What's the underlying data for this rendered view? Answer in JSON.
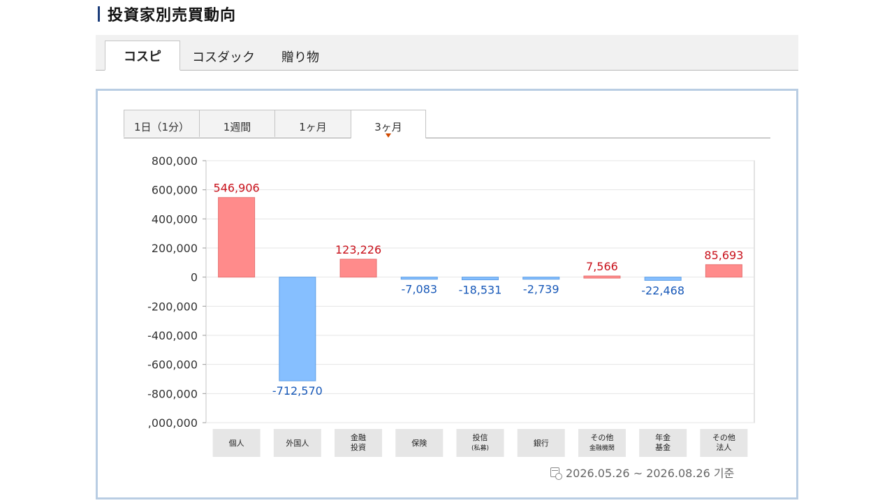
{
  "page": {
    "title": "投資家別売買動向"
  },
  "market_tabs": [
    {
      "label": "コスピ",
      "active": true
    },
    {
      "label": "コスダック",
      "active": false
    },
    {
      "label": "贈り物",
      "active": false
    }
  ],
  "period_tabs": [
    {
      "label": "1日（1分）",
      "active": false
    },
    {
      "label": "1週間",
      "active": false
    },
    {
      "label": "1ヶ月",
      "active": false
    },
    {
      "label": "3ヶ月",
      "active": true
    }
  ],
  "date_range": "2026.05.26 ~ 2026.08.26 기준",
  "colors": {
    "positive_bar": "#ff8b8b",
    "positive_label": "#c8101a",
    "negative_bar": "#86bfff",
    "negative_label": "#1758b8",
    "grid": "#e4e4e4",
    "axis_label_bg": "#e6e6e6"
  },
  "chart_data": {
    "type": "bar",
    "categories": [
      [
        "個人"
      ],
      [
        "外国人"
      ],
      [
        "金融",
        "投資"
      ],
      [
        "保険"
      ],
      [
        "投信",
        "(私募)"
      ],
      [
        "銀行"
      ],
      [
        "その他",
        "金融機関"
      ],
      [
        "年金",
        "基金"
      ],
      [
        "その他",
        "法人"
      ]
    ],
    "values": [
      546906,
      -712570,
      123226,
      -7083,
      -18531,
      -2739,
      7566,
      -22468,
      85693
    ],
    "value_labels": [
      "546,906",
      "-712,570",
      "123,226",
      "-7,083",
      "-18,531",
      "-2,739",
      "7,566",
      "-22,468",
      "85,693"
    ],
    "ylim": [
      -1000000,
      800000
    ],
    "yticks": [
      800000,
      600000,
      400000,
      200000,
      0,
      -200000,
      -400000,
      -600000,
      -800000,
      -1000000
    ],
    "ytick_labels": [
      "800,000",
      "600,000",
      "400,000",
      "200,000",
      "0",
      "-200,000",
      "-400,000",
      "-600,000",
      "-800,000",
      ",000,000"
    ],
    "grid": true
  }
}
